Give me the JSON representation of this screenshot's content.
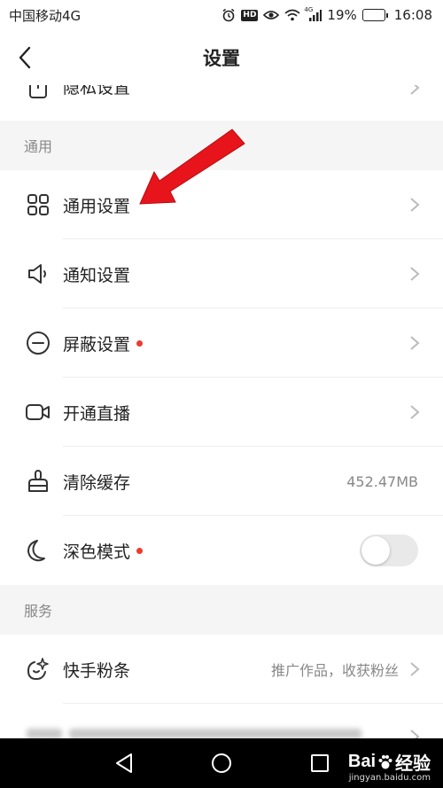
{
  "status_bar": {
    "carrier": "中国移动4G",
    "network_small": "4G",
    "battery_percent": "19%",
    "battery_level": 0.19,
    "time": "16:08",
    "hd_label": "HD"
  },
  "header": {
    "title": "设置"
  },
  "rows": {
    "privacy": {
      "label": "隐私设置",
      "icon": "lock-icon"
    },
    "general": {
      "label": "通用设置",
      "icon": "grid-icon"
    },
    "notify": {
      "label": "通知设置",
      "icon": "speaker-icon"
    },
    "block": {
      "label": "屏蔽设置",
      "icon": "minus-circle-icon",
      "has_dot": true
    },
    "live": {
      "label": "开通直播",
      "icon": "video-camera-icon"
    },
    "cache": {
      "label": "清除缓存",
      "icon": "broom-icon",
      "value": "452.47MB"
    },
    "dark": {
      "label": "深色模式",
      "icon": "moon-icon",
      "has_dot": true,
      "toggle_on": false
    },
    "fans": {
      "label": "快手粉条",
      "icon": "sparkle-icon",
      "value": "推广作品，收获粉丝"
    }
  },
  "sections": {
    "general": "通用",
    "service": "服务"
  },
  "watermark": {
    "logo_text": "Bai",
    "logo_text2": "经验",
    "url": "jingyan.baidu.com"
  },
  "colors": {
    "accent_red": "#ee3a2d",
    "section_bg": "#f5f5f5",
    "battery_yellow": "#f2b400"
  }
}
